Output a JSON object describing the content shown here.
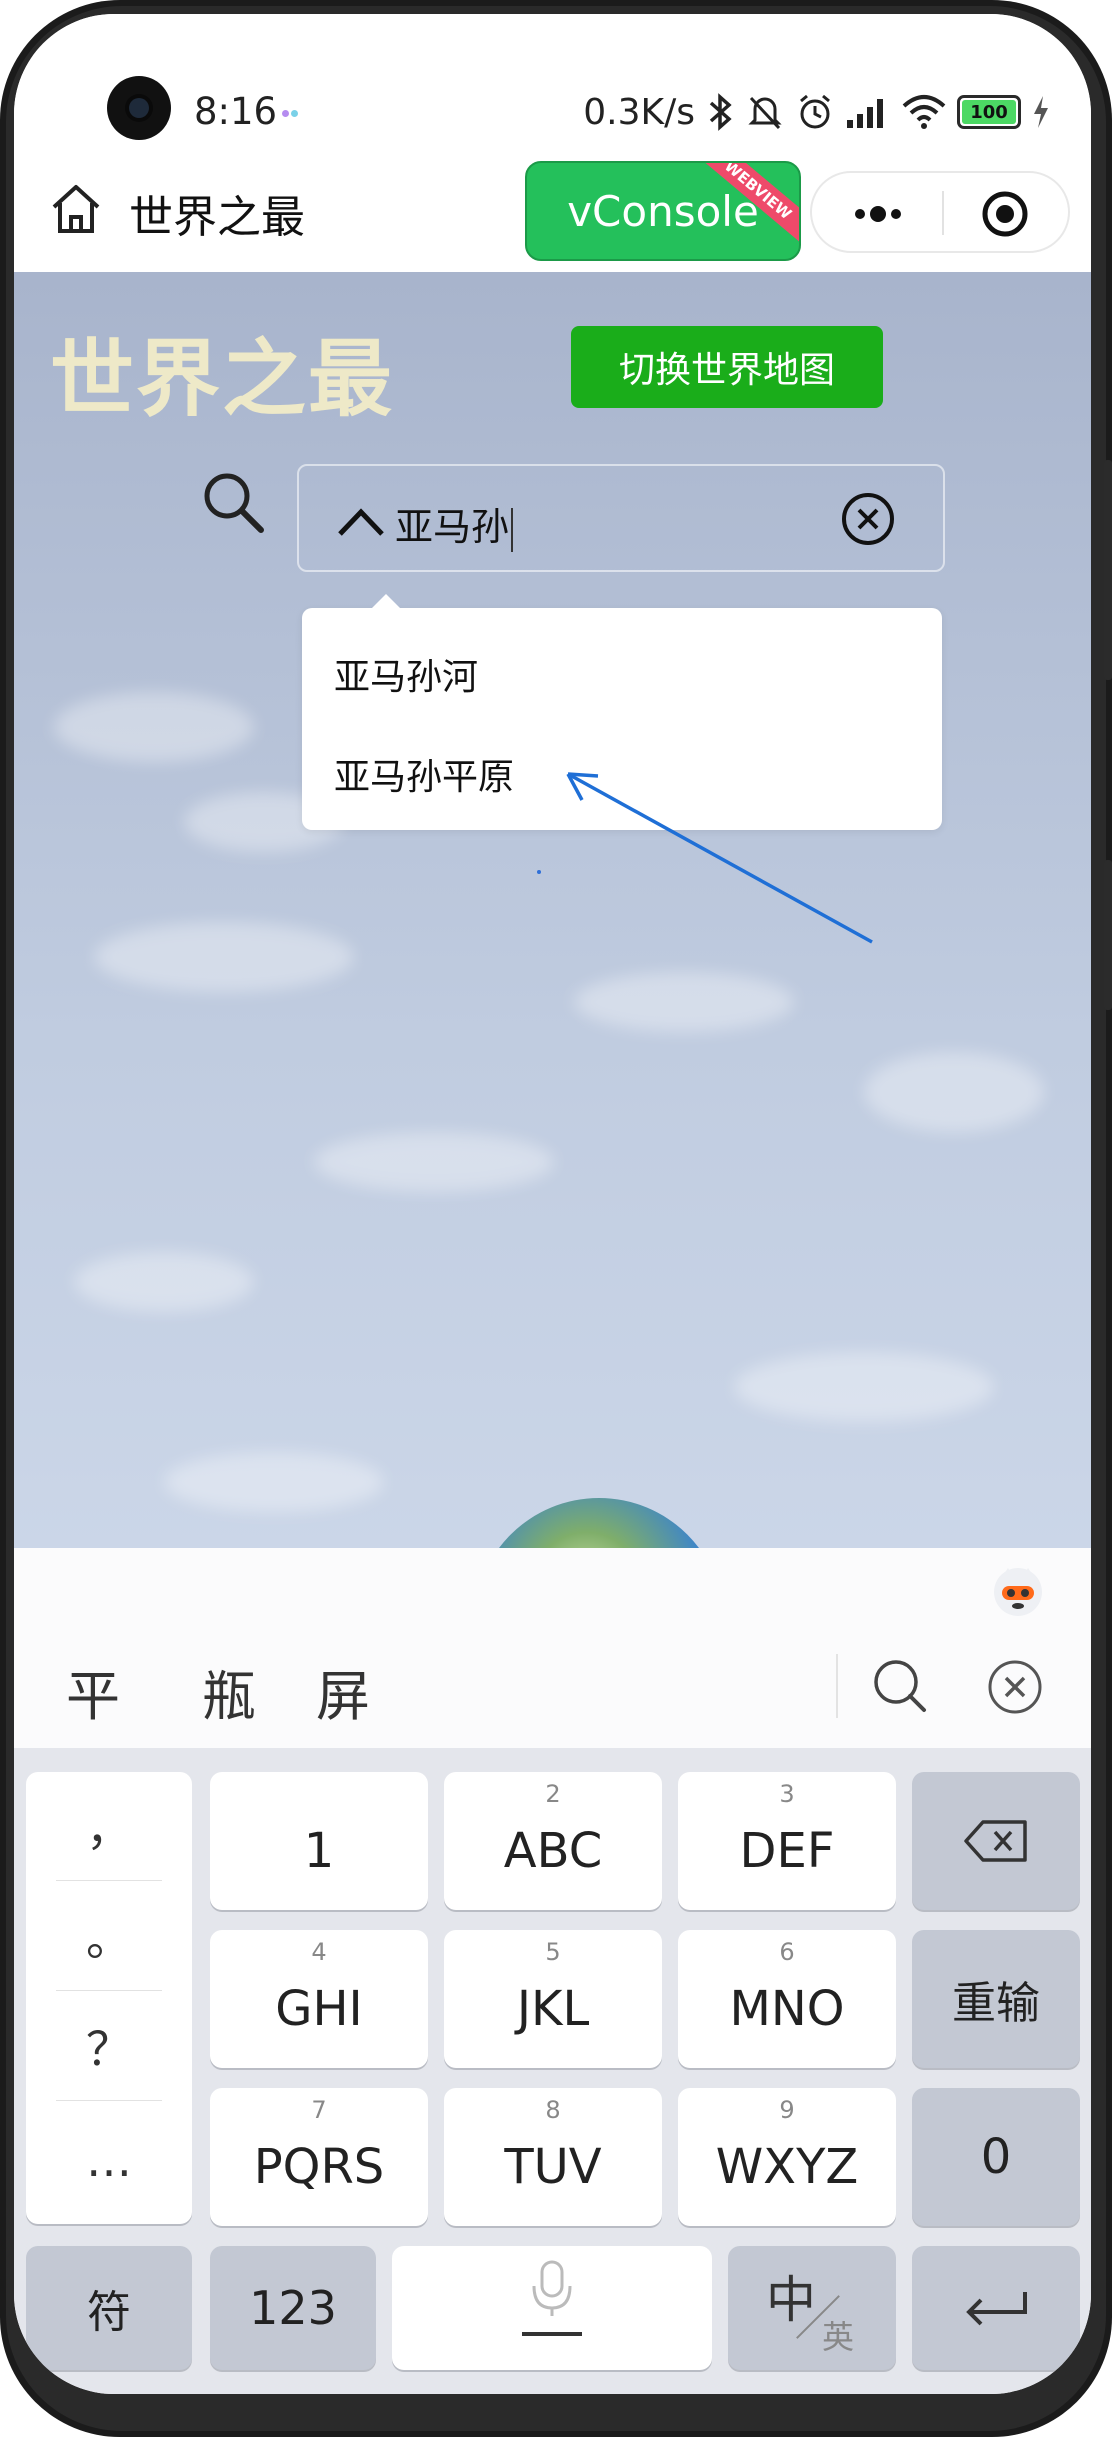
{
  "status_bar": {
    "time": "8:16",
    "net_speed": "0.3K/s",
    "battery": "100",
    "dot_colors": [
      "#b58cf0",
      "#7ad1e8",
      "#f0a8c8"
    ]
  },
  "header": {
    "title": "世界之最",
    "vconsole_label": "vConsole",
    "webview_ribbon": "WEBVIEW"
  },
  "main": {
    "big_title": "世界之最",
    "switch_button": "切换世界地图",
    "search_value": "亚马孙",
    "suggestions": [
      "亚马孙河",
      "亚马孙平原"
    ]
  },
  "keyboard": {
    "candidates": [
      "平",
      "瓶",
      "屏"
    ],
    "punctuation": [
      "，",
      "。",
      "？",
      "…"
    ],
    "keys": {
      "k1": {
        "main": "1",
        "sub": ""
      },
      "k2": {
        "main": "ABC",
        "sub": "2"
      },
      "k3": {
        "main": "DEF",
        "sub": "3"
      },
      "k4": {
        "main": "GHI",
        "sub": "4"
      },
      "k5": {
        "main": "JKL",
        "sub": "5"
      },
      "k6": {
        "main": "MNO",
        "sub": "6"
      },
      "k7": {
        "main": "PQRS",
        "sub": "7"
      },
      "k8": {
        "main": "TUV",
        "sub": "8"
      },
      "k9": {
        "main": "WXYZ",
        "sub": "9"
      }
    },
    "reenter": "重输",
    "zero": "0",
    "symbols": "符",
    "num_mode": "123",
    "lang_zh": "中",
    "lang_en": "英"
  },
  "colors": {
    "accent_green": "#24c05b",
    "switch_green": "#1aad1a",
    "title_cream": "#eee9c8",
    "annotation_blue": "#1f6fd6"
  }
}
